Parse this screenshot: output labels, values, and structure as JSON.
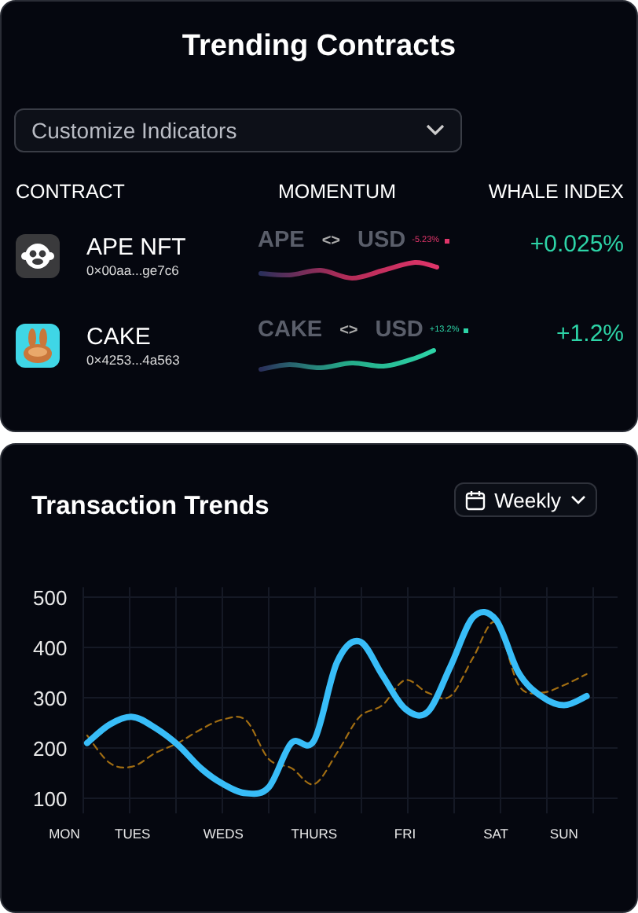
{
  "trending": {
    "title": "Trending Contracts",
    "indicator_select": {
      "value": "Customize Indicators"
    },
    "columns": [
      "CONTRACT",
      "MOMENTUM",
      "WHALE INDEX"
    ],
    "rows": [
      {
        "kind": "ape",
        "name": "APE NFT",
        "address": "0×00aa...ge7c6",
        "base": "APE",
        "swap": "<>",
        "quote": "USD",
        "change": "-5.23%",
        "color": "#e0356a",
        "whale": "+0.025%"
      },
      {
        "kind": "cake",
        "name": "CAKE",
        "address": "0×4253...4a563",
        "base": "CAKE",
        "swap": "<>",
        "quote": "USD",
        "change": "+13.2%",
        "color": "#2dd4a7",
        "whale": "+1.2%"
      }
    ]
  },
  "transactions": {
    "title": "Transaction Trends",
    "period_select": {
      "value": "Weekly"
    },
    "chart_data": {
      "type": "line",
      "grid": true,
      "ylim": [
        70,
        520
      ],
      "yticks": [
        {
          "value": 100,
          "label": "100"
        },
        {
          "value": 200,
          "label": "200"
        },
        {
          "value": 300,
          "label": "300"
        },
        {
          "value": 400,
          "label": "400"
        },
        {
          "value": 500,
          "label": "500"
        }
      ],
      "categories": [
        "MON",
        null,
        null,
        "TUES",
        null,
        null,
        null,
        "WEDS",
        null,
        null,
        null,
        "THURS",
        null,
        null,
        null,
        "FRI",
        null,
        null,
        null,
        "SAT",
        null,
        null,
        "SUN",
        null
      ],
      "series": [
        {
          "color": "#38bdf8",
          "line_style": "solid",
          "values": [
            null,
            210,
            247,
            262,
            240,
            206,
            160,
            128,
            110,
            122,
            210,
            215,
            370,
            412,
            345,
            278,
            272,
            362,
            460,
            455,
            350,
            303,
            285,
            303
          ]
        },
        {
          "color": "#a16d12",
          "line_style": "dashed",
          "values": [
            null,
            225,
            170,
            163,
            190,
            210,
            237,
            257,
            255,
            178,
            160,
            128,
            190,
            262,
            285,
            335,
            310,
            303,
            380,
            450,
            325,
            310,
            325,
            347
          ]
        }
      ]
    }
  }
}
